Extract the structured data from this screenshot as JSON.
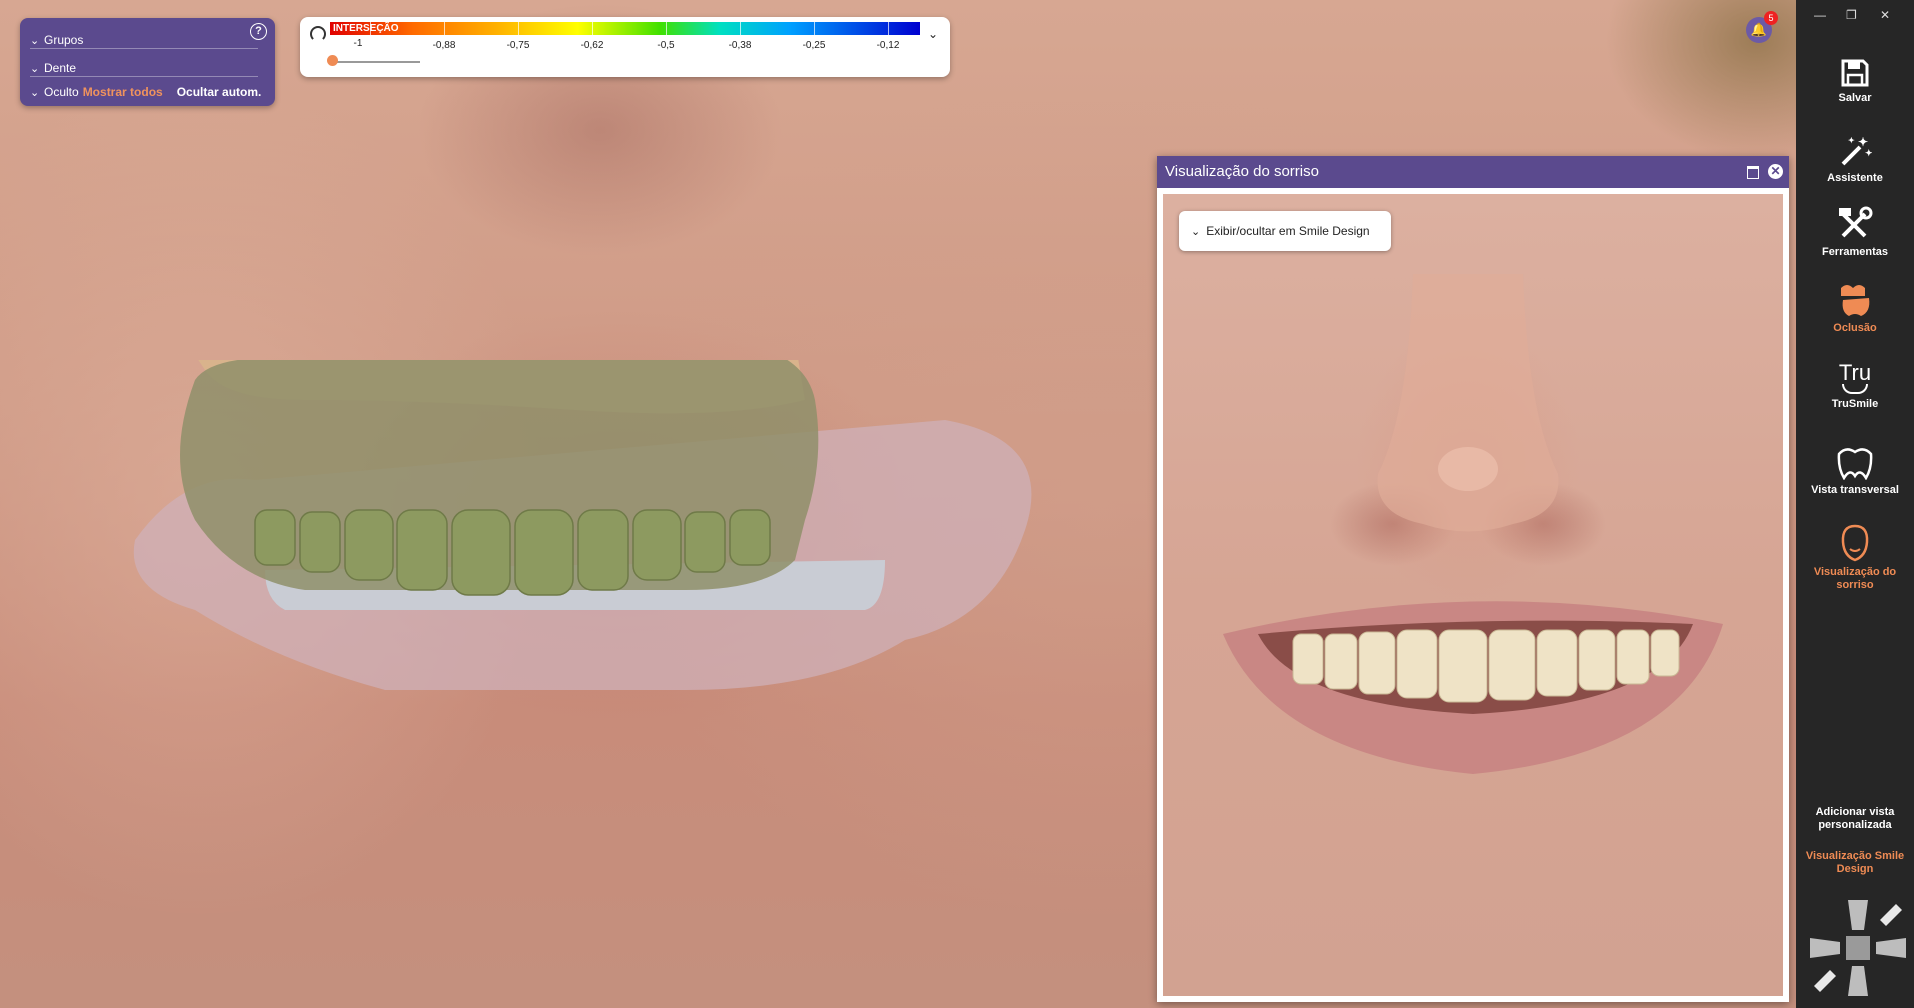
{
  "groups_panel": {
    "row1": "Grupos",
    "row2": "Dente",
    "row3": "Oculto",
    "show_all": "Mostrar todos",
    "hide_auto": "Ocultar autom.",
    "help": "?"
  },
  "color_scale": {
    "title": "INTERSEÇÃO",
    "ticks": [
      "-1",
      "-0,88",
      "-0,75",
      "-0,62",
      "-0,5",
      "-0,38",
      "-0,25",
      "-0,12"
    ],
    "slider_value": -1
  },
  "notifications": {
    "count": "5"
  },
  "smile_window": {
    "title": "Visualização do sorriso",
    "toggle_label": "Exibir/ocultar em Smile Design"
  },
  "toolbar": {
    "save": "Salvar",
    "assistant": "Assistente",
    "tools": "Ferramentas",
    "occlusion": "Oclusão",
    "trusmile": "TruSmile",
    "trusmile_icon_text": "Tru",
    "cross_section": "Vista transversal",
    "smile_view": "Visualização do sorriso",
    "add_custom_view": "Adicionar vista personalizada",
    "smile_design_view": "Visualização Smile Design"
  },
  "colors": {
    "panel_purple": "#5b4a8e",
    "accent_orange": "#ef8b54",
    "toolbar_bg": "#262626"
  }
}
